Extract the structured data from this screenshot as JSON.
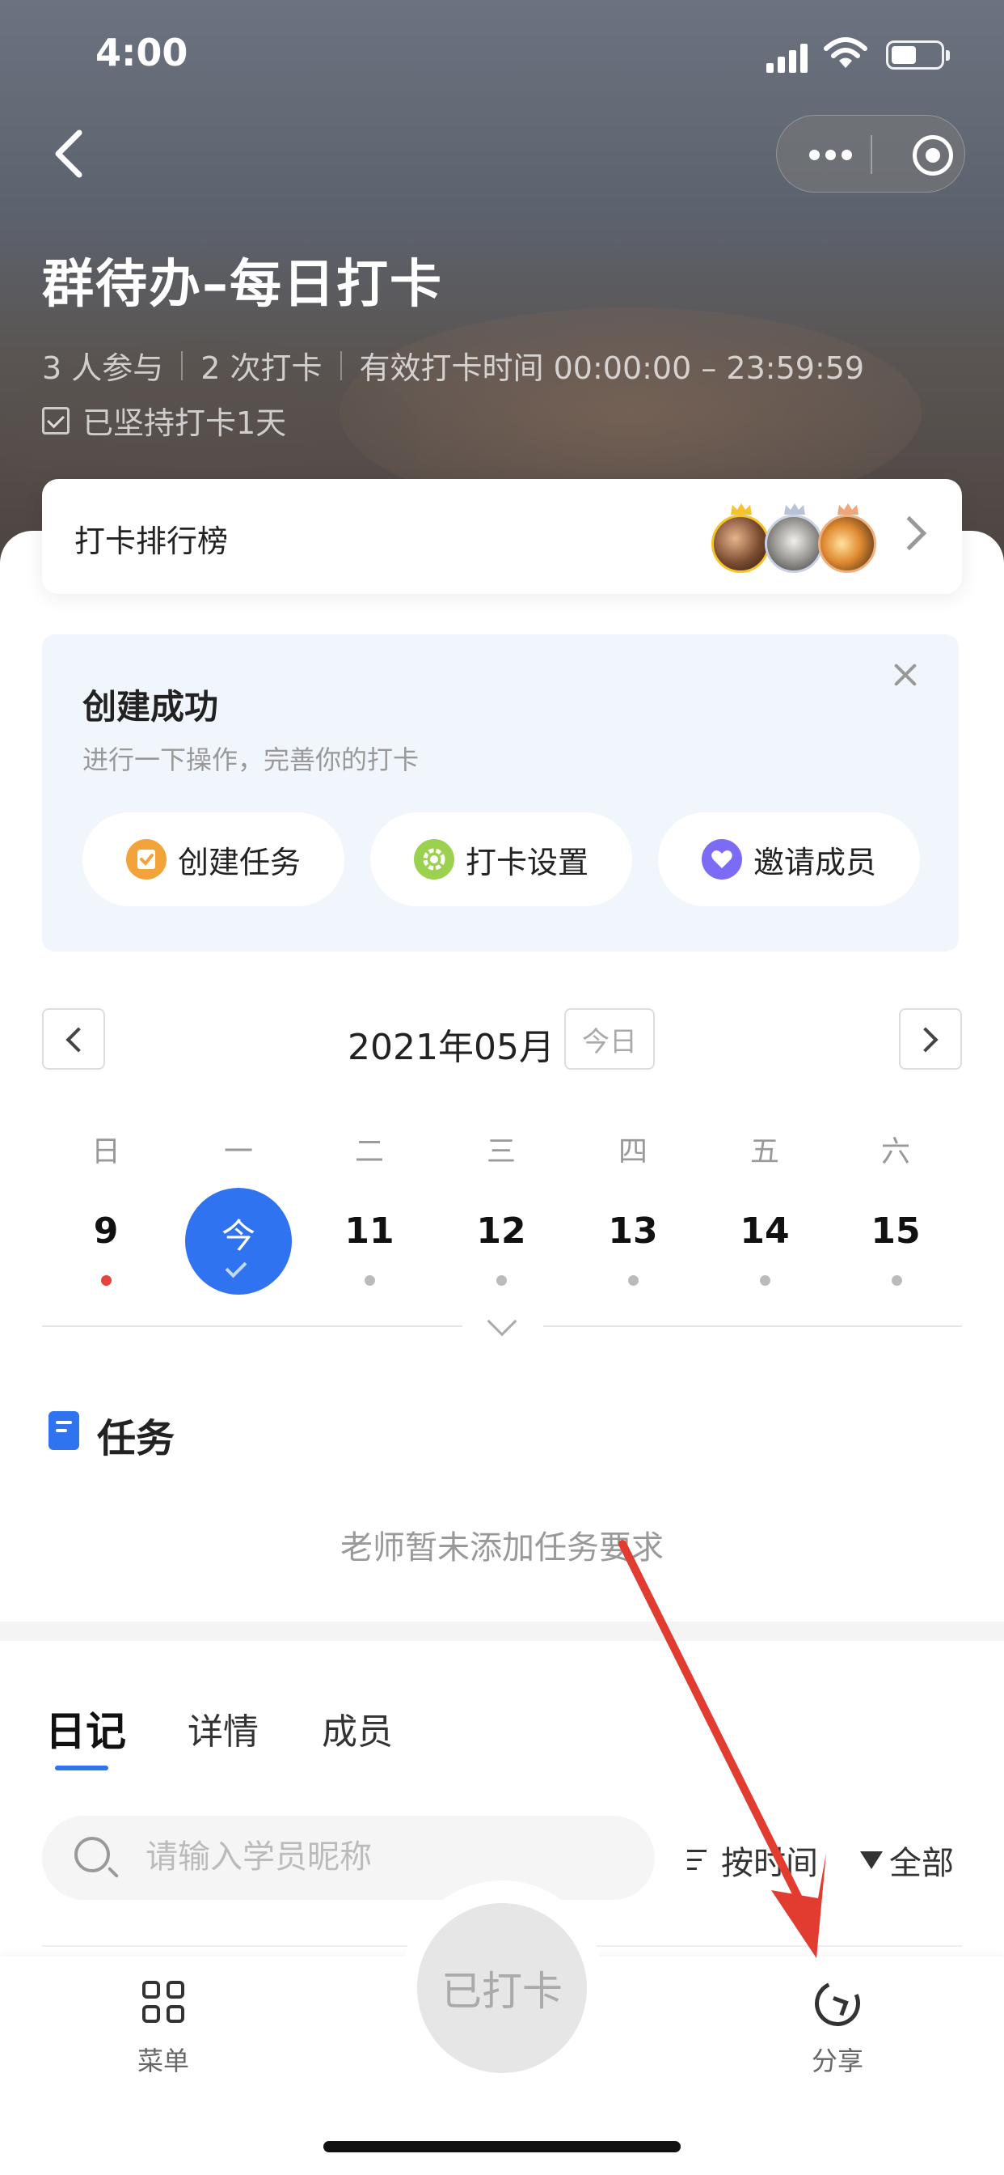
{
  "status_bar": {
    "time": "4:00"
  },
  "header": {
    "title": "群待办–每日打卡",
    "participants": "3 人参与",
    "checkins": "2 次打卡",
    "valid_time": "有效打卡时间 00:00:00 – 23:59:59",
    "persist": "已坚持打卡1天"
  },
  "ranking": {
    "label": "打卡排行榜"
  },
  "success_card": {
    "title": "创建成功",
    "subtitle": "进行一下操作，完善你的打卡",
    "actions": [
      {
        "label": "创建任务",
        "icon": "task-check-icon",
        "color": "#f2a33a"
      },
      {
        "label": "打卡设置",
        "icon": "gear-icon",
        "color": "#9bd14f"
      },
      {
        "label": "邀请成员",
        "icon": "heart-icon",
        "color": "#7c6cf5"
      }
    ]
  },
  "calendar": {
    "month": "2021年05月",
    "today_button": "今日",
    "weekdays": [
      "日",
      "一",
      "二",
      "三",
      "四",
      "五",
      "六"
    ],
    "days": [
      "9",
      "今",
      "11",
      "12",
      "13",
      "14",
      "15"
    ],
    "accent": "#2f73f0"
  },
  "tasks": {
    "title": "任务",
    "empty_text": "老师暂未添加任务要求"
  },
  "tabs": [
    "日记",
    "详情",
    "成员"
  ],
  "search": {
    "placeholder": "请输入学员昵称"
  },
  "sort": {
    "label": "按时间"
  },
  "filter": {
    "label": "全部"
  },
  "bottom_bar": {
    "menu": "菜单",
    "punch": "已打卡",
    "share": "分享"
  }
}
